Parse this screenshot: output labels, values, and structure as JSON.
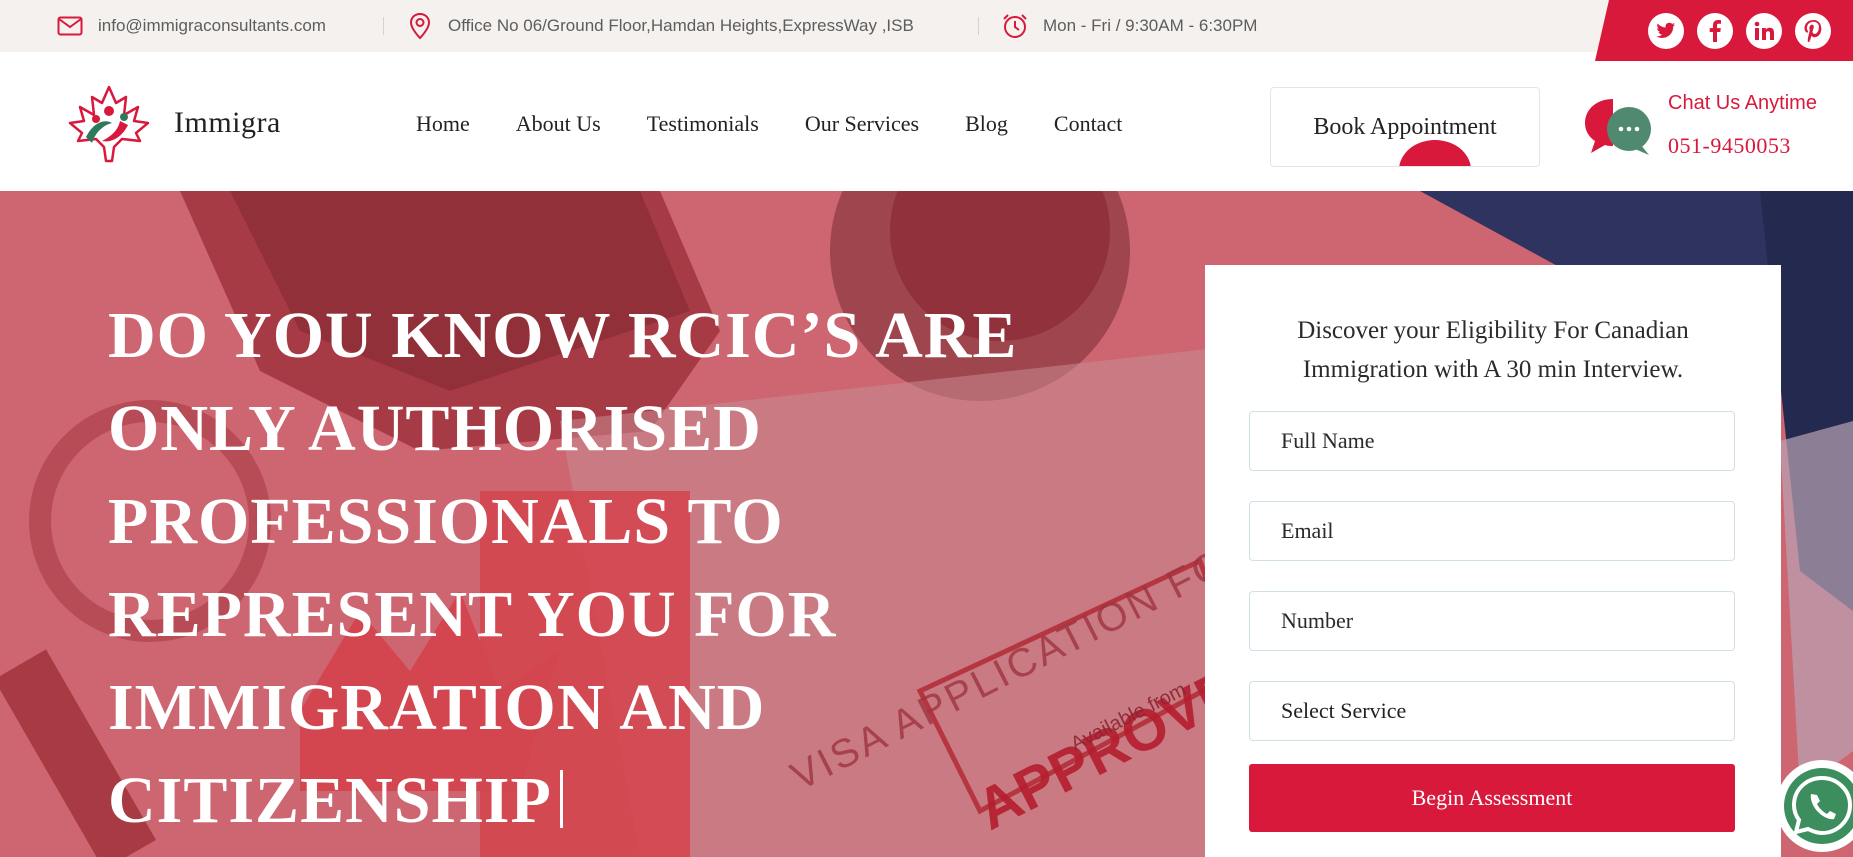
{
  "topbar": {
    "email": "info@immigraconsultants.com",
    "address": "Office No 06/Ground Floor,Hamdan Heights,ExpressWay ,ISB",
    "hours": "Mon - Fri / 9:30AM - 6:30PM",
    "social": [
      {
        "icon": "twitter-icon",
        "glyph": "t"
      },
      {
        "icon": "facebook-icon",
        "glyph": "f"
      },
      {
        "icon": "linkedin-icon",
        "glyph": "in"
      },
      {
        "icon": "pinterest-icon",
        "glyph": "p"
      }
    ]
  },
  "header": {
    "brand": "Immigra",
    "nav": [
      "Home",
      "About Us",
      "Testimonials",
      "Our Services",
      "Blog",
      "Contact"
    ],
    "book_label": "Book Appointment",
    "chat_title": "Chat Us Anytime",
    "chat_phone": "051-9450053"
  },
  "hero": {
    "headline": [
      "DO YOU KNOW RCIC’S ARE",
      "ONLY AUTHORISED",
      "PROFESSIONALS TO",
      "REPRESENT YOU FOR",
      "IMMIGRATION AND",
      "CITIZENSHIP"
    ],
    "bg_text": {
      "form": "VISA APPLICATION FORM",
      "stamp": "APPROVED",
      "stamp_sub": "Available from"
    }
  },
  "form": {
    "title_line1": "Discover your Eligibility For Canadian",
    "title_line2": "Immigration with A 30 min Interview.",
    "fields": {
      "full_name": "Full Name",
      "email": "Email",
      "number": "Number",
      "service": "Select Service"
    },
    "submit_label": "Begin Assessment"
  },
  "colors": {
    "accent": "#d8193c",
    "topbar_bg": "#f5f1ee",
    "hero_overlay": "#c8646c",
    "whatsapp": "#3d8e5f"
  }
}
